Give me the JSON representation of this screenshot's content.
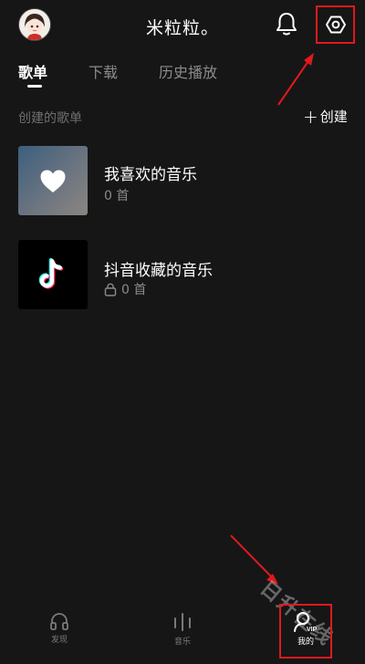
{
  "header": {
    "title": "米粒粒。"
  },
  "tabs": [
    {
      "label": "歌单",
      "active": true
    },
    {
      "label": "下载",
      "active": false
    },
    {
      "label": "历史播放",
      "active": false
    }
  ],
  "section": {
    "label": "创建的歌单",
    "create_label": "创建"
  },
  "playlists": [
    {
      "name": "我喜欢的音乐",
      "count": "0 首",
      "icon": "heart-icon",
      "locked": false
    },
    {
      "name": "抖音收藏的音乐",
      "count": "0 首",
      "icon": "tiktok-logo-icon",
      "locked": true
    }
  ],
  "bottom_nav": [
    {
      "label": "发现",
      "icon": "headphones-icon",
      "active": false
    },
    {
      "label": "音乐",
      "icon": "soundwave-icon",
      "active": false
    },
    {
      "label": "我的",
      "icon": "user-vip-icon",
      "active": true,
      "badge": "VIP"
    }
  ],
  "watermark": "日升在线",
  "colors": {
    "background": "#161616",
    "annotation": "#e0191e",
    "accent_cyan": "#25f4ee",
    "accent_pink": "#fe2c55"
  }
}
